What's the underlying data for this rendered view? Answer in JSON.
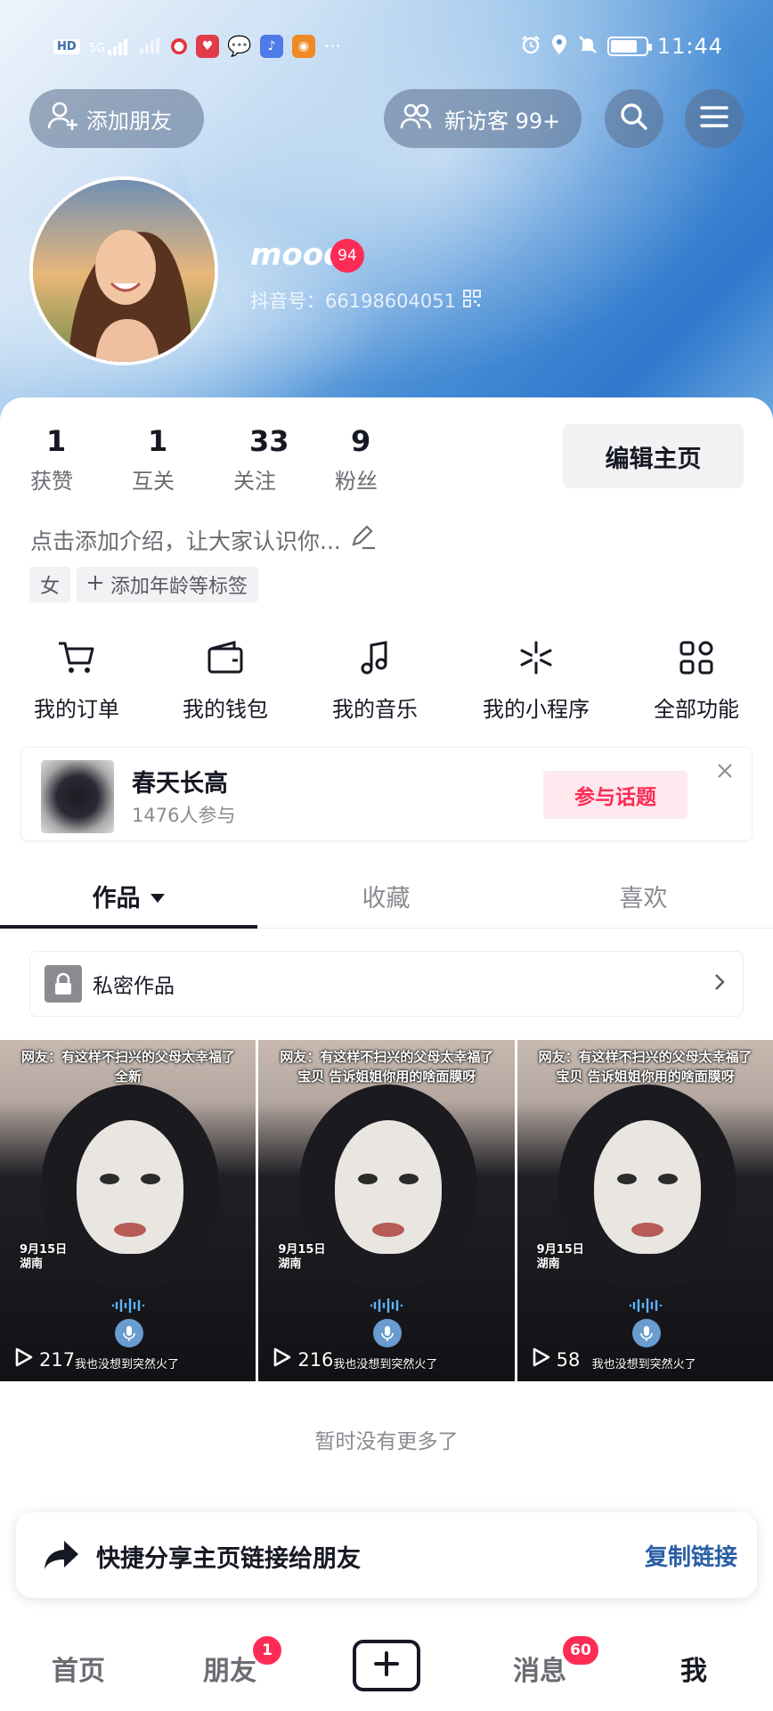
{
  "status_bar": {
    "network_label": "HD",
    "signal_label": "5G",
    "time": "11:44",
    "more": "···"
  },
  "header": {
    "add_friend_label": "添加朋友",
    "visitors_label": "新访客 99+"
  },
  "profile": {
    "nickname": "mood",
    "level": "94",
    "douyin_id": "抖音号：66198604051"
  },
  "stats": [
    {
      "value": "1",
      "label": "获赞"
    },
    {
      "value": "1",
      "label": "互关"
    },
    {
      "value": "33",
      "label": "关注"
    },
    {
      "value": "9",
      "label": "粉丝"
    }
  ],
  "edit_profile_label": "编辑主页",
  "bio_placeholder": "点击添加介绍，让大家认识你...",
  "tags": {
    "gender": "女",
    "add_tags": "添加年龄等标签"
  },
  "features": [
    {
      "label": "我的订单",
      "icon": "cart-icon"
    },
    {
      "label": "我的钱包",
      "icon": "wallet-icon"
    },
    {
      "label": "我的音乐",
      "icon": "music-note-icon"
    },
    {
      "label": "我的小程序",
      "icon": "mini-program-icon"
    },
    {
      "label": "全部功能",
      "icon": "grid-apps-icon"
    }
  ],
  "topic": {
    "title": "春天长高",
    "participants": "1476人参与",
    "join_label": "参与话题"
  },
  "tabs": [
    {
      "label": "作品",
      "active": true
    },
    {
      "label": "收藏",
      "active": false
    },
    {
      "label": "喜欢",
      "active": false
    }
  ],
  "private_works_label": "私密作品",
  "videos": [
    {
      "caption_line1": "网友：有这样不扫兴的父母太幸福了",
      "caption_line2": "全新",
      "date_line1": "9月15日",
      "date_line2": "湖南",
      "plays": "217",
      "subtitle": "我也没想到突然火了"
    },
    {
      "caption_line1": "网友：有这样不扫兴的父母太幸福了",
      "caption_line2": "宝贝 告诉姐姐你用的啥面膜呀",
      "date_line1": "9月15日",
      "date_line2": "湖南",
      "plays": "216",
      "subtitle": "我也没想到突然火了"
    },
    {
      "caption_line1": "网友：有这样不扫兴的父母太幸福了",
      "caption_line2": "宝贝 告诉姐姐你用的啥面膜呀",
      "date_line1": "9月15日",
      "date_line2": "湖南",
      "plays": "58",
      "subtitle": "我也没想到突然火了"
    }
  ],
  "no_more_label": "暂时没有更多了",
  "share_bar": {
    "text": "快捷分享主页链接给朋友",
    "copy_label": "复制链接"
  },
  "bottom_nav": {
    "home": "首页",
    "friends": "朋友",
    "friends_badge": "1",
    "messages": "消息",
    "messages_badge": "60",
    "me": "我"
  },
  "colors": {
    "accent": "#fe2c55",
    "link": "#2a5ea5",
    "text": "#161823"
  }
}
